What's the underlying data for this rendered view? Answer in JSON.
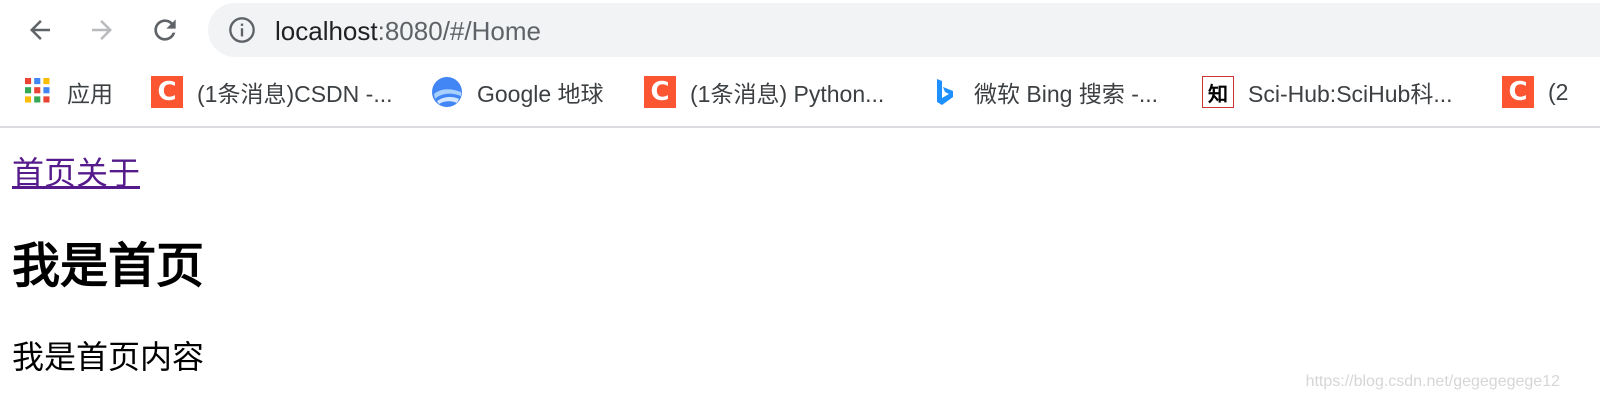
{
  "browser": {
    "url_host": "localhost",
    "url_path": ":8080/#/Home",
    "icons": {
      "back": "arrow-left-icon",
      "forward": "arrow-right-icon",
      "reload": "reload-icon",
      "site_info": "info-icon"
    }
  },
  "bookmarks": [
    {
      "label": "应用",
      "icon": "apps-grid-icon"
    },
    {
      "label": "(1条消息)CSDN -...",
      "icon": "csdn-icon"
    },
    {
      "label": "Google 地球",
      "icon": "google-earth-icon"
    },
    {
      "label": "(1条消息) Python...",
      "icon": "csdn-icon"
    },
    {
      "label": "微软 Bing 搜索 -...",
      "icon": "bing-icon"
    },
    {
      "label": "Sci-Hub:SciHub科...",
      "icon": "scihub-icon"
    },
    {
      "label": "(2",
      "icon": "csdn-icon"
    }
  ],
  "page": {
    "nav_links": "首页关于",
    "heading": "我是首页",
    "content": "我是首页内容"
  },
  "watermark": "https://blog.csdn.net/gegegegege12",
  "colors": {
    "omnibox_bg": "#f1f3f4",
    "csdn_brand": "#fc5531",
    "visited_link": "#551a8b"
  }
}
